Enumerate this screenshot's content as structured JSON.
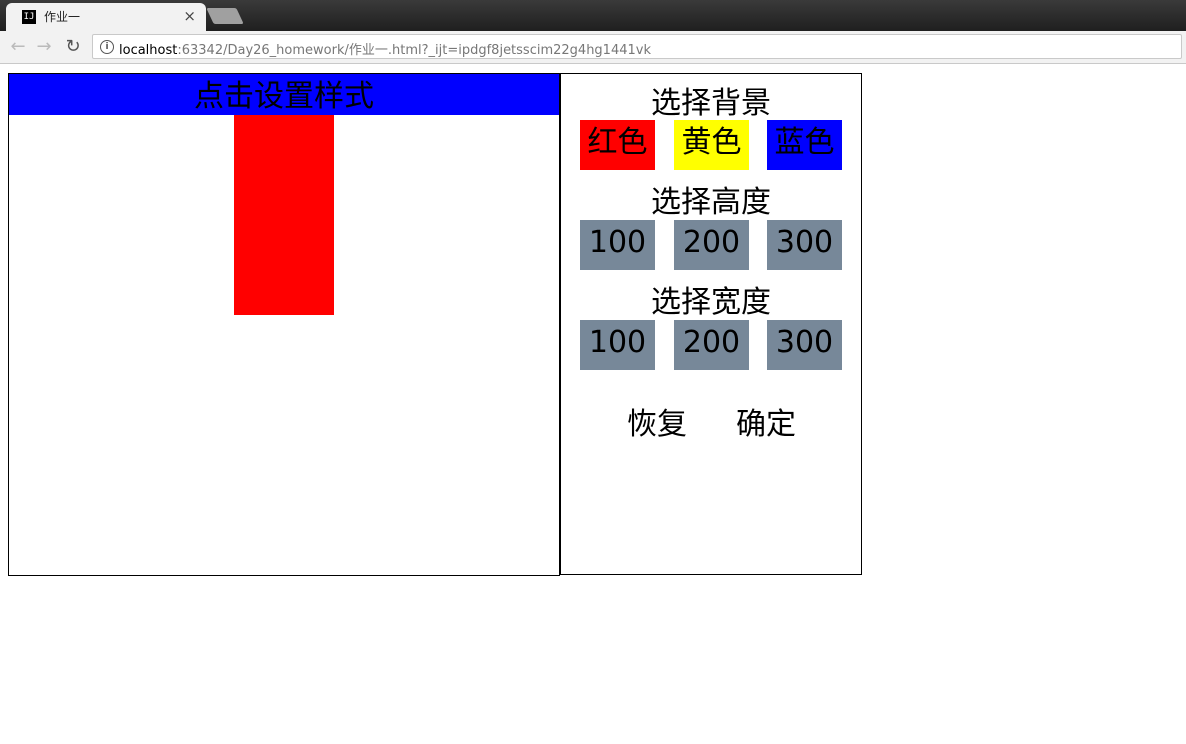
{
  "browser": {
    "tab_favicon": "IJ",
    "tab_title": "作业一",
    "tab_close": "×",
    "url_host": "localhost",
    "url_rest": ":63342/Day26_homework/作业一.html?_ijt=ipdgf8jetsscim22g4hg1441vk"
  },
  "page": {
    "banner_text": "点击设置样式",
    "preview_box_color": "#ff0000",
    "background_section": {
      "title": "选择背景",
      "options": [
        {
          "label": "红色",
          "color": "#ff0000"
        },
        {
          "label": "黄色",
          "color": "#ffff00"
        },
        {
          "label": "蓝色",
          "color": "#0000ff"
        }
      ]
    },
    "height_section": {
      "title": "选择高度",
      "options": [
        "100",
        "200",
        "300"
      ]
    },
    "width_section": {
      "title": "选择宽度",
      "options": [
        "100",
        "200",
        "300"
      ]
    },
    "actions": {
      "reset": "恢复",
      "confirm": "确定"
    }
  }
}
